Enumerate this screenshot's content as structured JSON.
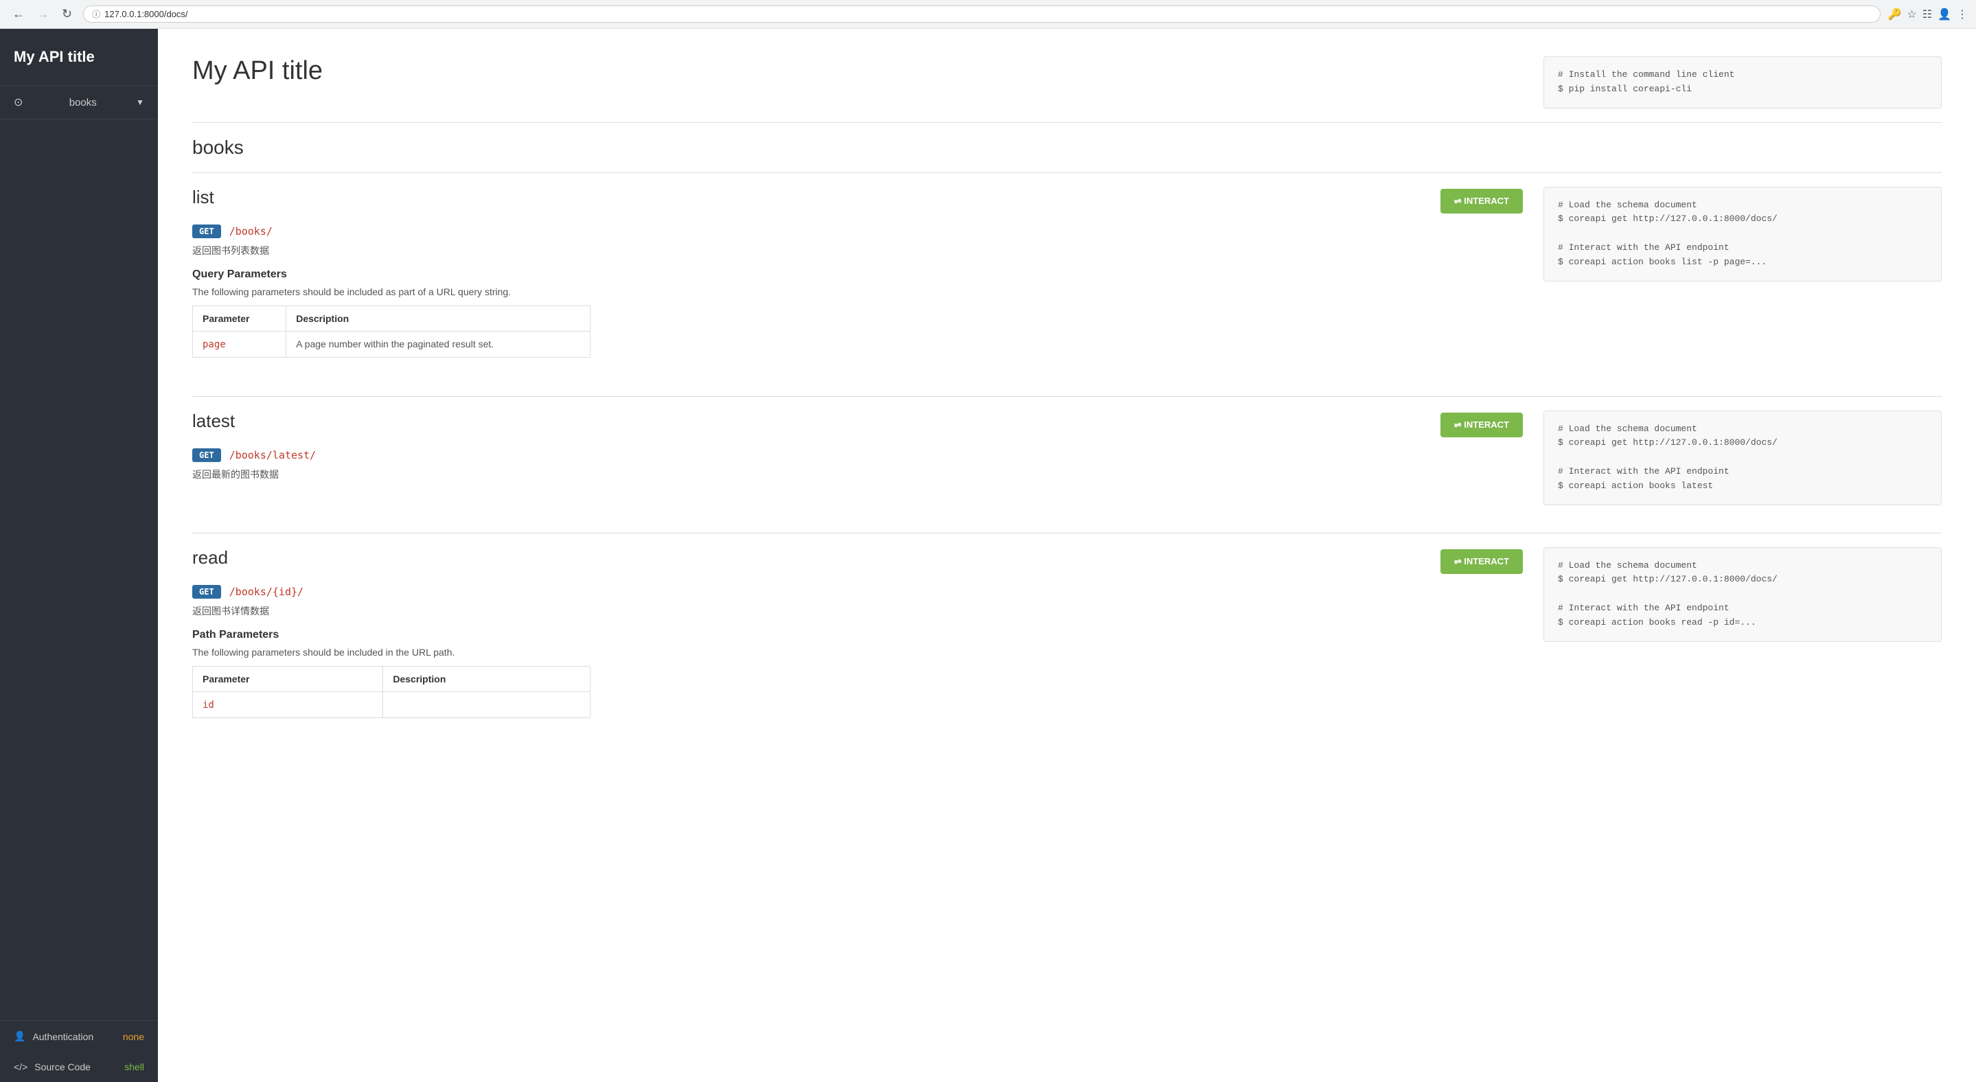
{
  "browser": {
    "url": "127.0.0.1:8000/docs/",
    "back_disabled": false,
    "forward_disabled": true
  },
  "sidebar": {
    "title": "My API title",
    "nav_items": [
      {
        "id": "books",
        "icon": "⊙",
        "label": "books",
        "has_chevron": true
      }
    ],
    "footer_items": [
      {
        "id": "authentication",
        "icon": "👤",
        "label": "Authentication",
        "value": "none",
        "value_color": "orange"
      },
      {
        "id": "source-code",
        "icon": "</>",
        "label": "Source Code",
        "value": "shell",
        "value_color": "green"
      }
    ]
  },
  "main": {
    "page_title": "My API title",
    "top_code": "# Install the command line client\n$ pip install coreapi-cli",
    "sections_heading": "books",
    "sections": [
      {
        "id": "list",
        "title": "list",
        "method": "GET",
        "path": "/books/",
        "description": "返回图书列表数据",
        "interact_label": "⇌ INTERACT",
        "has_query_params": true,
        "query_params_heading": "Query Parameters",
        "query_params_desc": "The following parameters should be included as part of a URL query string.",
        "params": [
          {
            "name": "page",
            "description": "A page number within the paginated result set."
          }
        ],
        "code": "# Load the schema document\n$ coreapi get http://127.0.0.1:8000/docs/\n\n# Interact with the API endpoint\n$ coreapi action books list -p page=..."
      },
      {
        "id": "latest",
        "title": "latest",
        "method": "GET",
        "path": "/books/latest/",
        "description": "返回最新的图书数据",
        "interact_label": "⇌ INTERACT",
        "has_query_params": false,
        "params": [],
        "code": "# Load the schema document\n$ coreapi get http://127.0.0.1:8000/docs/\n\n# Interact with the API endpoint\n$ coreapi action books latest"
      },
      {
        "id": "read",
        "title": "read",
        "method": "GET",
        "path": "/books/{id}/",
        "description": "返回图书详情数据",
        "interact_label": "⇌ INTERACT",
        "has_path_params": true,
        "path_params_heading": "Path Parameters",
        "path_params_desc": "The following parameters should be included in the URL path.",
        "params": [
          {
            "name": "id",
            "description": ""
          }
        ],
        "code": "# Load the schema document\n$ coreapi get http://127.0.0.1:8000/docs/\n\n# Interact with the API endpoint\n$ coreapi action books read -p id=..."
      }
    ],
    "table_headers": {
      "parameter": "Parameter",
      "description": "Description"
    }
  }
}
